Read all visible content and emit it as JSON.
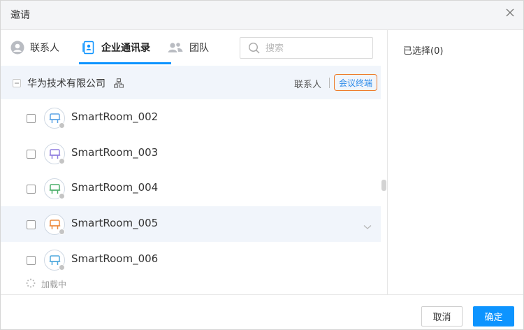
{
  "dialog": {
    "title": "邀请"
  },
  "tabs": [
    {
      "label": "联系人",
      "icon": "user-circle-icon"
    },
    {
      "label": "企业通讯录",
      "icon": "address-book-icon",
      "active": true
    },
    {
      "label": "团队",
      "icon": "team-icon"
    }
  ],
  "search": {
    "placeholder": "搜索",
    "value": ""
  },
  "org": {
    "name": "华为技术有限公司",
    "icon": "org-structure-icon",
    "contacts_link": "联系人",
    "conference_link": "会议终端"
  },
  "devices": [
    {
      "name": "SmartRoom_002",
      "color": "#5aa3e6"
    },
    {
      "name": "SmartRoom_003",
      "color": "#8f7ddf"
    },
    {
      "name": "SmartRoom_004",
      "color": "#4caf6a"
    },
    {
      "name": "SmartRoom_005",
      "color": "#ee8a3c"
    },
    {
      "name": "SmartRoom_006",
      "color": "#4fa8dd"
    }
  ],
  "loading_text": "加载中",
  "selected": {
    "label": "已选择(0)"
  },
  "footer": {
    "cancel_label": "取消",
    "ok_label": "确定"
  },
  "colors": {
    "accent": "#0d94ff",
    "highlight_border": "#ee7b2a",
    "hover_row": "#f1f5fb"
  }
}
